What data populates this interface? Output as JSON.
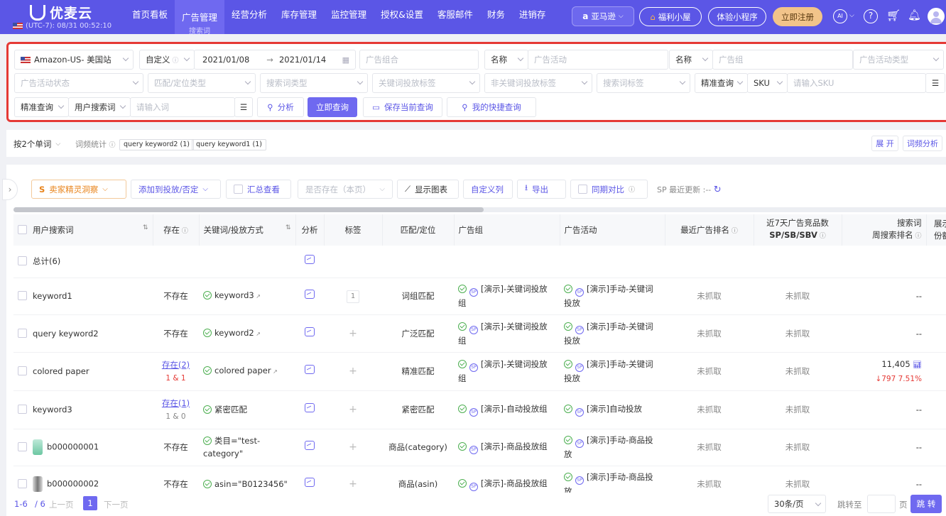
{
  "brand": {
    "name": "优麦云",
    "timezone": "(UTC-7): 08/31 00:52:10"
  },
  "nav": [
    {
      "label": "首页看板"
    },
    {
      "label": "广告管理",
      "sub": "搜索词"
    },
    {
      "label": "经营分析"
    },
    {
      "label": "库存管理"
    },
    {
      "label": "监控管理"
    },
    {
      "label": "授权&设置"
    },
    {
      "label": "客服邮件"
    },
    {
      "label": "财务"
    },
    {
      "label": "进销存"
    }
  ],
  "topright": {
    "amazon": "亚马逊",
    "fuli": "福利小屋",
    "tiyan": "体验小程序",
    "register": "立即注册",
    "ai": "AI"
  },
  "filters": {
    "store": "Amazon-US- 美国站",
    "custom": "自定义",
    "date_from": "2021/01/08",
    "date_arrow": "→",
    "date_to": "2021/01/14",
    "portfolio_ph": "广告组合",
    "name1": "名称",
    "campaign_ph": "广告活动",
    "name2": "名称",
    "adgroup_ph": "广告组",
    "campaign_type_ph": "广告活动类型",
    "campaign_status_ph": "广告活动状态",
    "match_ph": "匹配/定位类型",
    "search_type_ph": "搜索词类型",
    "keyword_tag_ph": "关键词投放标签",
    "nonkw_tag_ph": "非关键词投放标签",
    "search_tag_ph": "搜索词标签",
    "exact1": "精准查询",
    "sku": "SKU",
    "sku_ph": "请输入SKU",
    "exact2": "精准查询",
    "user_search": "用户搜索词",
    "word_ph": "请输入词",
    "analyze": "分析",
    "query_now": "立即查询",
    "save_query": "保存当前查询",
    "my_query": "我的快捷查询"
  },
  "wordbar": {
    "by_words": "按2个单词",
    "freq": "词频统计",
    "chips": [
      "query keyword2 (1)",
      "query keyword1 (1)"
    ],
    "expand": "展 开",
    "word_analysis": "词频分析"
  },
  "toolbar": {
    "seller": "卖家精灵洞察",
    "add": "添加到投放/否定",
    "summary": "汇总查看",
    "exists_ph": "是否存在（本页）",
    "show_chart": "显示图表",
    "custom_cols": "自定义列",
    "export": "导出",
    "yoy": "同期对比",
    "sp_update": "SP 最近更新 :--"
  },
  "columns": {
    "search": "用户搜索词",
    "exist": "存在",
    "kw": "关键词/投放方式",
    "analysis": "分析",
    "tag": "标签",
    "match": "匹配/定位",
    "adgroup": "广告组",
    "campaign": "广告活动",
    "rank": "最近广告排名",
    "comp1": "近7天广告竞品数",
    "comp2": "SP/SB/SBV",
    "week1": "搜索词",
    "week2": "周搜索排名",
    "share1": "展示",
    "share2": "份额"
  },
  "total": "总计(6)",
  "rows": [
    {
      "term": "keyword1",
      "exist": "不存在",
      "kw": "keyword3",
      "tag": "1",
      "match": "词组匹配",
      "adgroup": "[演示]-关键词投放组",
      "campaign": "[演示]手动-关键词投放",
      "rank": "未抓取",
      "comp": "未抓取",
      "week": "--"
    },
    {
      "term": "query keyword2",
      "exist": "不存在",
      "kw": "keyword2",
      "match": "广泛匹配",
      "adgroup": "[演示]-关键词投放组",
      "campaign": "[演示]手动-关键词投放",
      "rank": "未抓取",
      "comp": "未抓取",
      "week": "--"
    },
    {
      "term": "colored paper",
      "exist": "存在(2)",
      "exist_sub": "1 & 1",
      "kw": "colored paper",
      "match": "精准匹配",
      "adgroup": "[演示]-关键词投放组",
      "campaign": "[演示]手动-关键词投放",
      "rank": "未抓取",
      "comp": "未抓取",
      "week": "11,405",
      "week_change": "↓797  7.51%"
    },
    {
      "term": "keyword3",
      "exist": "存在(1)",
      "exist_sub": "1 & 0",
      "kw": "紧密匹配",
      "match": "紧密匹配",
      "adgroup": "[演示]-自动投放组",
      "campaign": "[演示]自动投放",
      "rank": "未抓取",
      "comp": "未抓取",
      "week": "--"
    },
    {
      "term": "b000000001",
      "exist": "不存在",
      "kw": "类目=\"test-category\"",
      "match": "商品(category)",
      "adgroup": "[演示]-商品投放组",
      "campaign": "[演示]手动-商品投放",
      "rank": "未抓取",
      "comp": "未抓取",
      "week": "--"
    },
    {
      "term": "b000000002",
      "exist": "不存在",
      "kw": "asin=\"B0123456\"",
      "match": "商品(asin)",
      "adgroup": "[演示]-商品投放组",
      "campaign": "[演示]手动-商品投放",
      "rank": "未抓取",
      "comp": "未抓取",
      "week": "--"
    }
  ],
  "pagination": {
    "range": "1-6",
    "total": "/ 6",
    "prev": "上一页",
    "page": "1",
    "next": "下一页",
    "per_page": "30条/页",
    "jump": "跳转至",
    "page_unit": "页",
    "go": "跳 转"
  },
  "colors": {
    "primary": "#5b56e6",
    "highlight_border": "#e53935"
  }
}
